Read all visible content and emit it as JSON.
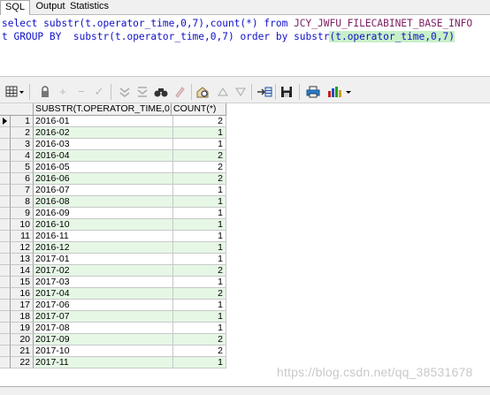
{
  "tabs": [
    {
      "label": "SQL"
    },
    {
      "label": "Output"
    },
    {
      "label": "Statistics"
    }
  ],
  "sql": {
    "line1": [
      {
        "t": "select substr(",
        "c": "kw"
      },
      {
        "t": "t.operator_time",
        "c": "kw"
      },
      {
        "t": ",0,7),count(*) from ",
        "c": "kw"
      },
      {
        "t": "JCY_JWFU_FILECABINET_BASE_INFO",
        "c": "tx"
      }
    ],
    "line2": [
      {
        "t": "t ",
        "c": "kw"
      },
      {
        "t": "GROUP BY  ",
        "c": "kw"
      },
      {
        "t": "substr(t.operator_time,0,7) ",
        "c": "kw"
      },
      {
        "t": "order by ",
        "c": "kw"
      },
      {
        "t": "substr",
        "c": "kw"
      },
      {
        "t": "(t.operator_time,0,7)",
        "c": "hl"
      }
    ]
  },
  "toolbar": {
    "icons": [
      "grid-menu-icon",
      "lock-icon",
      "add-record-icon",
      "delete-record-icon",
      "post-changes-icon",
      "filter-down-icon",
      "filter-down-all-icon",
      "find-icon",
      "clear-icon",
      "query-by-example-icon",
      "previous-icon",
      "next-icon",
      "export-icon",
      "save-icon",
      "print-icon",
      "chart-icon"
    ]
  },
  "grid": {
    "columns": [
      "SUBSTR(T.OPERATOR_TIME,0,7)",
      "COUNT(*)"
    ],
    "rows": [
      {
        "n": "1",
        "period": "2016-01",
        "count": "2"
      },
      {
        "n": "2",
        "period": "2016-02",
        "count": "1"
      },
      {
        "n": "3",
        "period": "2016-03",
        "count": "1"
      },
      {
        "n": "4",
        "period": "2016-04",
        "count": "2"
      },
      {
        "n": "5",
        "period": "2016-05",
        "count": "2"
      },
      {
        "n": "6",
        "period": "2016-06",
        "count": "2"
      },
      {
        "n": "7",
        "period": "2016-07",
        "count": "1"
      },
      {
        "n": "8",
        "period": "2016-08",
        "count": "1"
      },
      {
        "n": "9",
        "period": "2016-09",
        "count": "1"
      },
      {
        "n": "10",
        "period": "2016-10",
        "count": "1"
      },
      {
        "n": "11",
        "period": "2016-11",
        "count": "1"
      },
      {
        "n": "12",
        "period": "2016-12",
        "count": "1"
      },
      {
        "n": "13",
        "period": "2017-01",
        "count": "1"
      },
      {
        "n": "14",
        "period": "2017-02",
        "count": "2"
      },
      {
        "n": "15",
        "period": "2017-03",
        "count": "1"
      },
      {
        "n": "16",
        "period": "2017-04",
        "count": "2"
      },
      {
        "n": "17",
        "period": "2017-06",
        "count": "1"
      },
      {
        "n": "18",
        "period": "2017-07",
        "count": "1"
      },
      {
        "n": "19",
        "period": "2017-08",
        "count": "1"
      },
      {
        "n": "20",
        "period": "2017-09",
        "count": "2"
      },
      {
        "n": "21",
        "period": "2017-10",
        "count": "2"
      },
      {
        "n": "22",
        "period": "2017-11",
        "count": "1"
      }
    ]
  },
  "watermark": "https://blog.csdn.net/qq_38531678",
  "colors": {
    "keyword": "#1010c8",
    "table_name": "#7a1d62",
    "alt_row": "#e6f7e6",
    "highlight": "#c8f0c8"
  }
}
